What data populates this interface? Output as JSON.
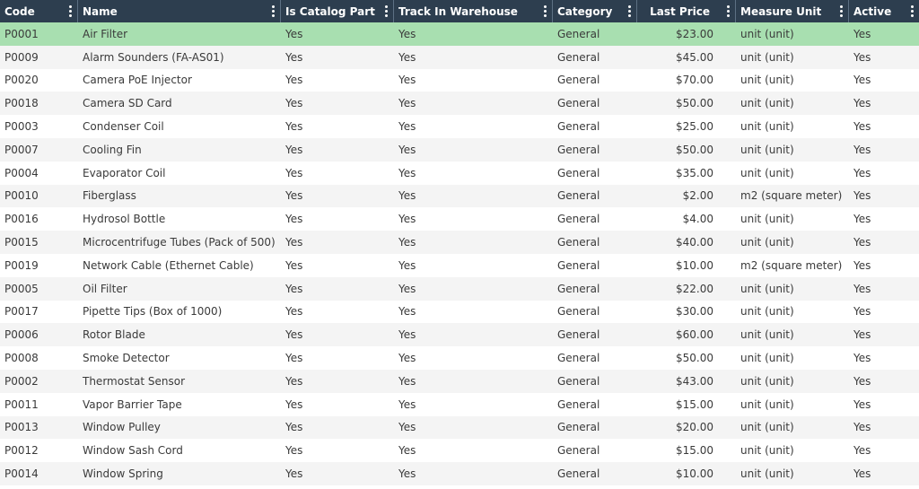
{
  "columns": [
    {
      "label": "Code",
      "align": "left"
    },
    {
      "label": "Name",
      "align": "left"
    },
    {
      "label": "Is Catalog Part",
      "align": "left"
    },
    {
      "label": "Track In Warehouse",
      "align": "left"
    },
    {
      "label": "Category",
      "align": "left"
    },
    {
      "label": "Last Price",
      "align": "right"
    },
    {
      "label": "Measure Unit",
      "align": "left"
    },
    {
      "label": "Active",
      "align": "left"
    }
  ],
  "selected_row": 0,
  "rows": [
    [
      "P0001",
      "Air Filter",
      "Yes",
      "Yes",
      "General",
      "$23.00",
      "unit (unit)",
      "Yes"
    ],
    [
      "P0009",
      "Alarm Sounders (FA-AS01)",
      "Yes",
      "Yes",
      "General",
      "$45.00",
      "unit (unit)",
      "Yes"
    ],
    [
      "P0020",
      "Camera PoE Injector",
      "Yes",
      "Yes",
      "General",
      "$70.00",
      "unit (unit)",
      "Yes"
    ],
    [
      "P0018",
      "Camera SD Card",
      "Yes",
      "Yes",
      "General",
      "$50.00",
      "unit (unit)",
      "Yes"
    ],
    [
      "P0003",
      "Condenser Coil",
      "Yes",
      "Yes",
      "General",
      "$25.00",
      "unit (unit)",
      "Yes"
    ],
    [
      "P0007",
      "Cooling Fin",
      "Yes",
      "Yes",
      "General",
      "$50.00",
      "unit (unit)",
      "Yes"
    ],
    [
      "P0004",
      "Evaporator Coil",
      "Yes",
      "Yes",
      "General",
      "$35.00",
      "unit (unit)",
      "Yes"
    ],
    [
      "P0010",
      "Fiberglass",
      "Yes",
      "Yes",
      "General",
      "$2.00",
      "m2 (square meter)",
      "Yes"
    ],
    [
      "P0016",
      "Hydrosol Bottle",
      "Yes",
      "Yes",
      "General",
      "$4.00",
      "unit (unit)",
      "Yes"
    ],
    [
      "P0015",
      "Microcentrifuge Tubes (Pack of 500)",
      "Yes",
      "Yes",
      "General",
      "$40.00",
      "unit (unit)",
      "Yes"
    ],
    [
      "P0019",
      "Network Cable (Ethernet Cable)",
      "Yes",
      "Yes",
      "General",
      "$10.00",
      "m2 (square meter)",
      "Yes"
    ],
    [
      "P0005",
      "Oil Filter",
      "Yes",
      "Yes",
      "General",
      "$22.00",
      "unit (unit)",
      "Yes"
    ],
    [
      "P0017",
      "Pipette Tips (Box of 1000)",
      "Yes",
      "Yes",
      "General",
      "$30.00",
      "unit (unit)",
      "Yes"
    ],
    [
      "P0006",
      "Rotor Blade",
      "Yes",
      "Yes",
      "General",
      "$60.00",
      "unit (unit)",
      "Yes"
    ],
    [
      "P0008",
      "Smoke Detector",
      "Yes",
      "Yes",
      "General",
      "$50.00",
      "unit (unit)",
      "Yes"
    ],
    [
      "P0002",
      "Thermostat Sensor",
      "Yes",
      "Yes",
      "General",
      "$43.00",
      "unit (unit)",
      "Yes"
    ],
    [
      "P0011",
      "Vapor Barrier Tape",
      "Yes",
      "Yes",
      "General",
      "$15.00",
      "unit (unit)",
      "Yes"
    ],
    [
      "P0013",
      "Window Pulley",
      "Yes",
      "Yes",
      "General",
      "$20.00",
      "unit (unit)",
      "Yes"
    ],
    [
      "P0012",
      "Window Sash Cord",
      "Yes",
      "Yes",
      "General",
      "$15.00",
      "unit (unit)",
      "Yes"
    ],
    [
      "P0014",
      "Window Spring",
      "Yes",
      "Yes",
      "General",
      "$10.00",
      "unit (unit)",
      "Yes"
    ]
  ],
  "colors": {
    "header_bg": "#2d3e4f",
    "selected_row_bg": "#a8dfb0",
    "alt_row_bg": "#f4f4f4"
  },
  "icons": {
    "column_menu": "kebab-menu-icon"
  }
}
